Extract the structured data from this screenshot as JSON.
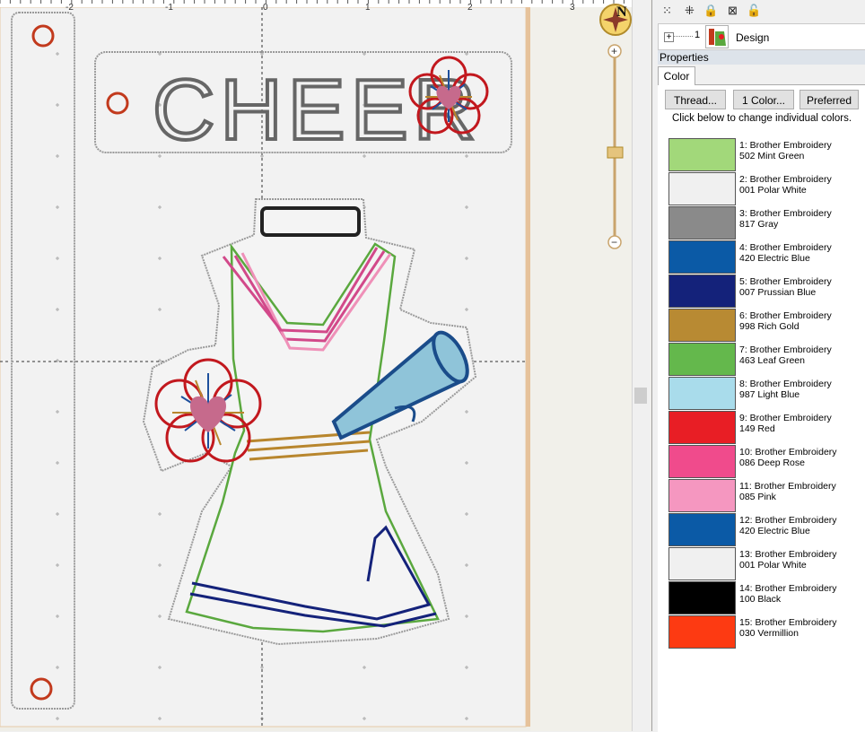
{
  "ruler": {
    "labels": [
      "-2",
      "-1",
      "0",
      "1",
      "2",
      "3"
    ]
  },
  "compass": {
    "letter": "N"
  },
  "zoom": {
    "plus": "+",
    "minus": "−",
    "level_fraction": 0.53
  },
  "design": {
    "cheer_text": "CHEER"
  },
  "toolbar": {
    "icons": [
      "select-icon",
      "select-all-icon",
      "lock-icon",
      "hide-icon",
      "unlock-icon"
    ]
  },
  "tree": {
    "expander": "+",
    "number": "1",
    "label": "Design"
  },
  "properties": {
    "header": "Properties",
    "tab": "Color",
    "buttons": {
      "thread": "Thread...",
      "one_color": "1 Color...",
      "preferred": "Preferred"
    },
    "hint": "Click below to change individual colors.",
    "colors": [
      {
        "line1": "1: Brother Embroidery",
        "line2": "502 Mint Green",
        "hex": "#a2d87a"
      },
      {
        "line1": "2: Brother Embroidery",
        "line2": "001 Polar White",
        "hex": "#f0f0f0"
      },
      {
        "line1": "3: Brother Embroidery",
        "line2": "817 Gray",
        "hex": "#8a8a8a"
      },
      {
        "line1": "4: Brother Embroidery",
        "line2": "420 Electric Blue",
        "hex": "#0b5aa6"
      },
      {
        "line1": "5: Brother Embroidery",
        "line2": "007 Prussian Blue",
        "hex": "#14227a"
      },
      {
        "line1": "6: Brother Embroidery",
        "line2": "998 Rich Gold",
        "hex": "#b88a33"
      },
      {
        "line1": "7: Brother Embroidery",
        "line2": "463 Leaf Green",
        "hex": "#64b84c"
      },
      {
        "line1": "8: Brother Embroidery",
        "line2": "987 Light Blue",
        "hex": "#a9dceb"
      },
      {
        "line1": "9: Brother Embroidery",
        "line2": "149 Red",
        "hex": "#e81e25"
      },
      {
        "line1": "10: Brother Embroidery",
        "line2": "086 Deep Rose",
        "hex": "#f04b8c"
      },
      {
        "line1": "11: Brother Embroidery",
        "line2": "085 Pink",
        "hex": "#f597c0"
      },
      {
        "line1": "12: Brother Embroidery",
        "line2": "420 Electric Blue",
        "hex": "#0b5aa6"
      },
      {
        "line1": "13: Brother Embroidery",
        "line2": "001 Polar White",
        "hex": "#f0f0f0"
      },
      {
        "line1": "14: Brother Embroidery",
        "line2": "100 Black",
        "hex": "#000000"
      },
      {
        "line1": "15: Brother Embroidery",
        "line2": "030 Vermillion",
        "hex": "#fd3a12"
      }
    ]
  }
}
